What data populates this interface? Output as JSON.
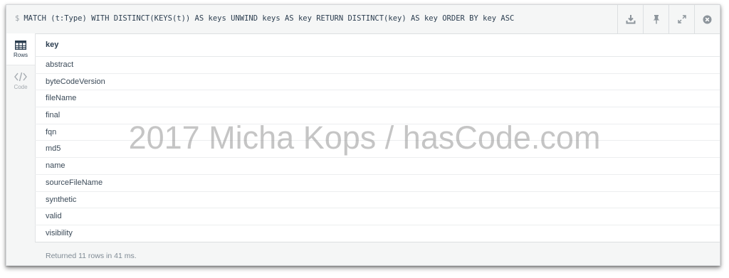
{
  "query": {
    "prompt": "$",
    "text": "MATCH (t:Type) WITH DISTINCT(KEYS(t)) AS keys UNWIND keys AS key RETURN DISTINCT(key) AS key ORDER BY key ASC"
  },
  "actions": [
    {
      "icon": "download-icon"
    },
    {
      "icon": "pin-icon"
    },
    {
      "icon": "expand-icon"
    },
    {
      "icon": "close-icon"
    }
  ],
  "sidebar": {
    "tabs": [
      {
        "label": "Rows",
        "icon": "table-icon",
        "active": true
      },
      {
        "label": "Code",
        "icon": "code-icon",
        "active": false
      }
    ]
  },
  "table": {
    "header": "key",
    "rows": [
      "abstract",
      "byteCodeVersion",
      "fileName",
      "final",
      "fqn",
      "md5",
      "name",
      "sourceFileName",
      "synthetic",
      "valid",
      "visibility"
    ]
  },
  "status": {
    "text": "Returned 11 rows in 41 ms."
  },
  "watermark": "2017 Micha Kops / hasCode.com",
  "colors": {
    "bar_bg": "#f5f6f6",
    "icon": "#8d959c",
    "text": "#3b4a58"
  }
}
